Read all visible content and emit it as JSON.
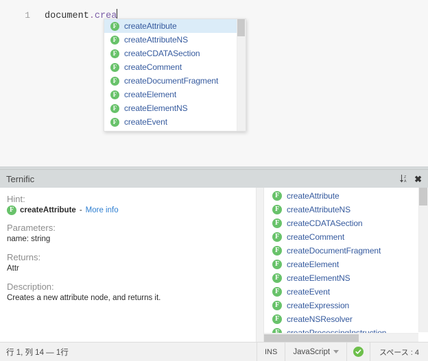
{
  "editor": {
    "line_number": "1",
    "code_prefix": "document",
    "code_dot": ".",
    "code_property": "crea",
    "full_text": "document.crea"
  },
  "autocomplete": {
    "selected_index": 0,
    "icon": "function-badge-icon",
    "icon_letter": "F",
    "items": [
      {
        "label": "createAttribute"
      },
      {
        "label": "createAttributeNS"
      },
      {
        "label": "createCDATASection"
      },
      {
        "label": "createComment"
      },
      {
        "label": "createDocumentFragment"
      },
      {
        "label": "createElement"
      },
      {
        "label": "createElementNS"
      },
      {
        "label": "createEvent"
      }
    ]
  },
  "panel": {
    "title": "Ternific",
    "sort_icon": "sort-descending-icon",
    "close_icon": "close-icon"
  },
  "hint": {
    "hint_label": "Hint:",
    "fn_icon_letter": "F",
    "fn_name": "createAttribute",
    "separator": "-",
    "more_info_label": "More info",
    "parameters_label": "Parameters:",
    "parameters_value": "name: string",
    "returns_label": "Returns:",
    "returns_value": "Attr",
    "description_label": "Description:",
    "description_value": "Creates a new attribute node, and returns it."
  },
  "list": {
    "icon_letter": "F",
    "items": [
      {
        "label": "createAttribute"
      },
      {
        "label": "createAttributeNS"
      },
      {
        "label": "createCDATASection"
      },
      {
        "label": "createComment"
      },
      {
        "label": "createDocumentFragment"
      },
      {
        "label": "createElement"
      },
      {
        "label": "createElementNS"
      },
      {
        "label": "createEvent"
      },
      {
        "label": "createExpression"
      },
      {
        "label": "createNSResolver"
      },
      {
        "label": "createProcessingInstruction"
      }
    ]
  },
  "status_bar": {
    "cursor_position": "行 1, 列 14 — 1行",
    "insert_mode": "INS",
    "language": "JavaScript",
    "lint_status_icon": "check-circle-icon",
    "indentation": "スペース : 4"
  },
  "colors": {
    "accent_green": "#68c26a",
    "link_blue": "#2f7fd1",
    "item_text_blue": "#355a9e",
    "selection_blue": "#dbecf8",
    "panel_header_gray": "#d6dadb",
    "status_bar_gray": "#f1f1f1"
  }
}
